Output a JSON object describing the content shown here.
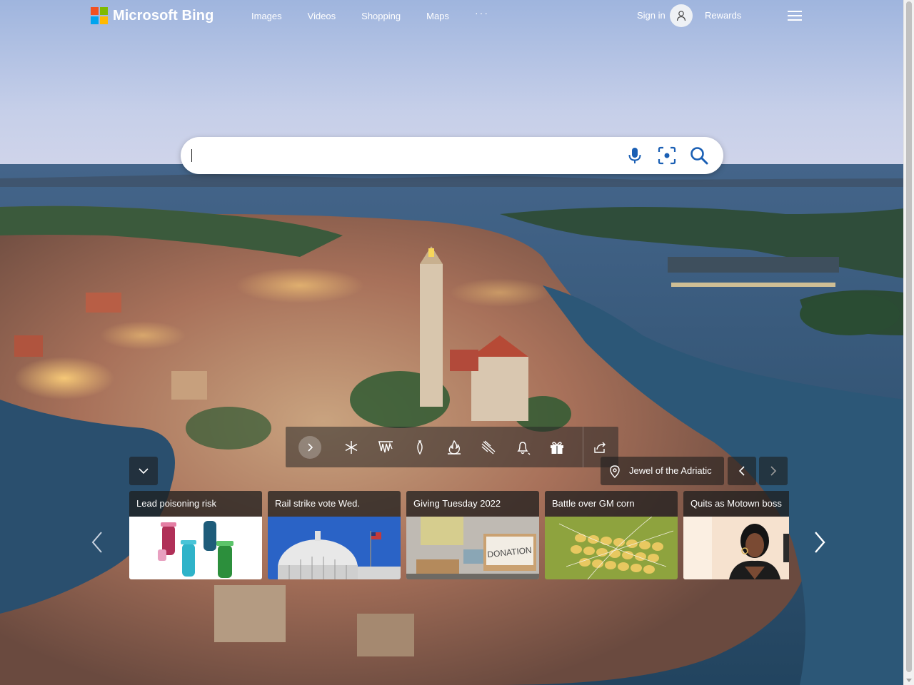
{
  "header": {
    "logo_text": "Microsoft Bing",
    "nav": [
      "Images",
      "Videos",
      "Shopping",
      "Maps"
    ],
    "more": "···",
    "signin": "Sign in",
    "rewards": "Rewards"
  },
  "search": {
    "value": "",
    "placeholder": ""
  },
  "image_info": {
    "title": "Jewel of the Adriatic"
  },
  "news_cards": [
    {
      "title": "Lead poisoning risk"
    },
    {
      "title": "Rail strike vote Wed."
    },
    {
      "title": "Giving Tuesday 2022"
    },
    {
      "title": "Battle over GM corn"
    },
    {
      "title": "Quits as Motown boss"
    }
  ],
  "colors": {
    "ms_red": "#f25022",
    "ms_green": "#7fba00",
    "ms_blue": "#00a4ef",
    "ms_yellow": "#ffb900",
    "accent_search": "#1a5fb4"
  }
}
